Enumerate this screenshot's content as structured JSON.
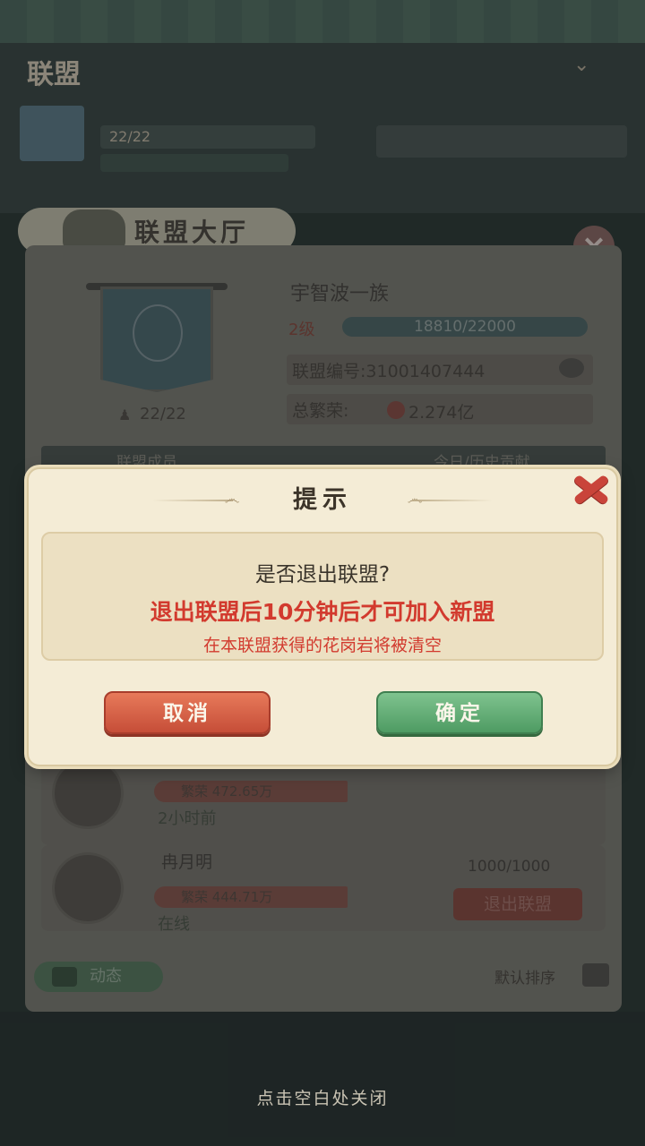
{
  "background": {
    "header_title": "联盟",
    "header_sub": "…",
    "member_count_top": "22/22",
    "hall_title": "联盟大厅",
    "alliance_name": "宇智波一族",
    "level": "2级",
    "exp": "18810/22000",
    "alliance_id_label": "联盟编号:31001407444",
    "prosperity_label": "总繁荣:",
    "prosperity_value": "2.274亿",
    "members": "22/22",
    "tab_left": "联盟成员",
    "tab_right": "今日/历史贡献",
    "member1": {
      "contribution": "繁荣 472.65万",
      "status": "2小时前"
    },
    "member2": {
      "name": "冉月明",
      "contribution": "繁荣 444.71万",
      "status": "在线",
      "exp": "1000/1000",
      "leave_label": "退出联盟"
    },
    "dynamic_label": "动态",
    "sort_label": "默认排序"
  },
  "dialog": {
    "title": "提示",
    "question": "是否退出联盟?",
    "warning": "退出联盟后10分钟后才可加入新盟",
    "note": "在本联盟获得的花岗岩将被清空",
    "cancel_label": "取消",
    "confirm_label": "确定"
  },
  "close_hint": "点击空白处关闭",
  "colors": {
    "warning_text": "#d23a2e",
    "cancel_button": "#d9614a",
    "confirm_button": "#62ad76",
    "dialog_bg": "#f4ecd6"
  }
}
